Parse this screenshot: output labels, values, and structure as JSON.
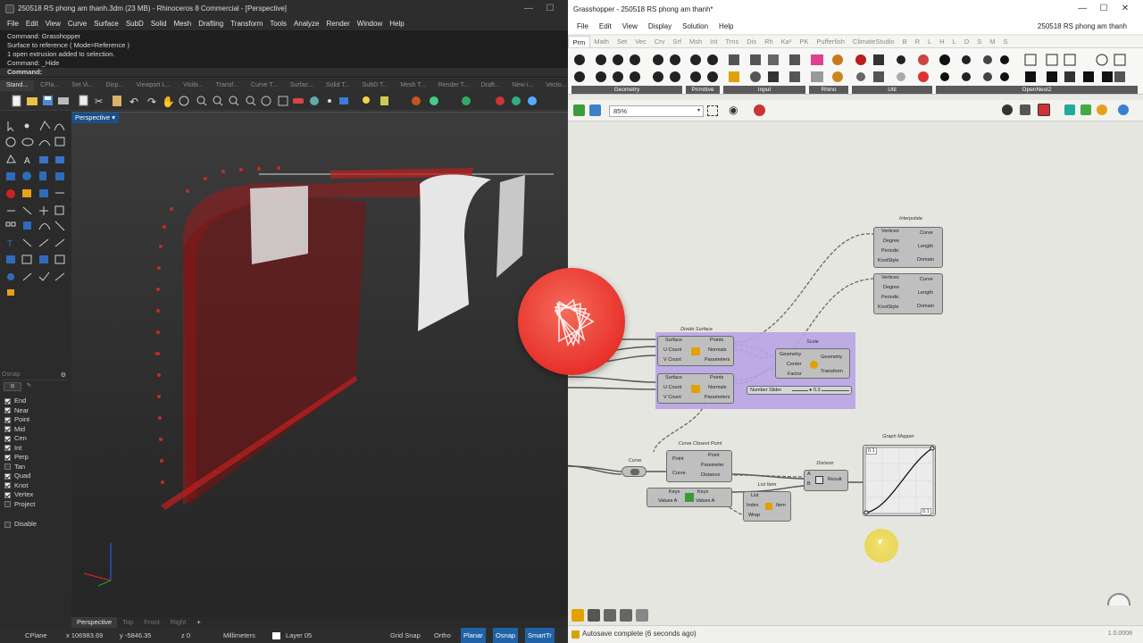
{
  "rhino": {
    "title": "250518 RS phong am thanh.3dm (23 MB) - Rhinoceros 8 Commercial - [Perspective]",
    "menu": [
      "File",
      "Edit",
      "View",
      "Curve",
      "Surface",
      "SubD",
      "Solid",
      "Mesh",
      "Drafting",
      "Transform",
      "Tools",
      "Analyze",
      "Render",
      "Window",
      "Help"
    ],
    "command_history": [
      "Command: Grasshopper",
      "Surface to reference ( Mode=Reference )",
      "1 open extrusion added to selection.",
      "Command: _Hide"
    ],
    "command_prompt": "Command:",
    "toolbar_tabs": [
      "Stand...",
      "CPla...",
      "Set Vi...",
      "Disp...",
      "Viewport L...",
      "Visibi...",
      "Transf...",
      "Curve T...",
      "Surfac...",
      "Solid T...",
      "SubD T...",
      "Mesh T...",
      "Render T...",
      "Draft...",
      "New i...",
      "Vecto..."
    ],
    "viewport_label": "Perspective",
    "osnap_title": "Osnap",
    "osnap_items": [
      {
        "label": "End",
        "checked": true
      },
      {
        "label": "Near",
        "checked": true
      },
      {
        "label": "Point",
        "checked": true
      },
      {
        "label": "Mid",
        "checked": true
      },
      {
        "label": "Cen",
        "checked": true
      },
      {
        "label": "Int",
        "checked": true
      },
      {
        "label": "Perp",
        "checked": true
      },
      {
        "label": "Tan",
        "checked": false
      },
      {
        "label": "Quad",
        "checked": true
      },
      {
        "label": "Knot",
        "checked": true
      },
      {
        "label": "Vertex",
        "checked": true
      },
      {
        "label": "Project",
        "checked": false
      }
    ],
    "osnap_disable": "Disable",
    "viewport_tabs": [
      "Perspective",
      "Top",
      "Front",
      "Right",
      "+"
    ],
    "status": {
      "cplane": "CPlane",
      "x": "x 106983.69",
      "y": "y -5846.35",
      "z": "z 0",
      "units": "Millimeters",
      "layer": "Layer 05",
      "grid_snap": "Grid Snap",
      "ortho": "Ortho",
      "planar": "Planar",
      "osnap": "Osnap",
      "smarttrack": "SmartTr"
    }
  },
  "grasshopper": {
    "title": "Grasshopper - 250518 RS phong am thanh*",
    "menu": [
      "File",
      "Edit",
      "View",
      "Display",
      "Solution",
      "Help"
    ],
    "doc_name": "250518 RS phong am thanh",
    "tabs": [
      "Prm",
      "Math",
      "Set",
      "Vec",
      "Crv",
      "Srf",
      "Msh",
      "Int",
      "Trns",
      "Dis",
      "Rh",
      "Ka²",
      "PK",
      "Pufferfish",
      "ClimateStudio",
      "B",
      "R",
      "L",
      "H",
      "L",
      "D",
      "S",
      "M",
      "S"
    ],
    "ribbon_groups": [
      "Geometry",
      "Primitive",
      "Input",
      "Rhino",
      "Util",
      "OpenNest2"
    ],
    "zoom": "85%",
    "components": {
      "interpolate": {
        "title": "Interpolate",
        "inputs": [
          "Vertices",
          "Degree",
          "Periodic",
          "KnotStyle"
        ],
        "outputs": [
          "Curve",
          "Length",
          "Domain"
        ]
      },
      "interpolate2": {
        "inputs": [
          "Vertices",
          "Degree",
          "Periodic",
          "KnotStyle"
        ],
        "outputs": [
          "Curve",
          "Length",
          "Domain"
        ]
      },
      "divide_surface": {
        "title": "Divide Surface",
        "inputs": [
          "Surface",
          "U Count",
          "V Count"
        ],
        "outputs": [
          "Points",
          "Normals",
          "Parameters"
        ]
      },
      "divide_surface2": {
        "inputs": [
          "Surface",
          "U Count",
          "V Count"
        ],
        "outputs": [
          "Points",
          "Normals",
          "Parameters"
        ]
      },
      "scale": {
        "title": "Scale",
        "inputs": [
          "Geometry",
          "Center",
          "Factor"
        ],
        "outputs": [
          "Geometry",
          "Transform"
        ]
      },
      "number_slider": {
        "label": "Number Slider",
        "value": "0.3"
      },
      "curve_param": {
        "label": "Curve"
      },
      "curve_closest_point": {
        "title": "Curve Closest Point",
        "inputs": [
          "Point",
          "Curve"
        ],
        "outputs": [
          "Point",
          "Parameter",
          "Distance"
        ]
      },
      "keys_values": {
        "inputs": [
          "Keys",
          "Values A"
        ],
        "outputs": [
          "Keys",
          "Values A"
        ]
      },
      "list_item": {
        "title": "List Item",
        "inputs": [
          "List",
          "Index",
          "Wrap"
        ],
        "outputs": [
          "Item"
        ]
      },
      "division": {
        "title": "Division",
        "inputs": [
          "A",
          "B"
        ],
        "outputs": [
          "Result"
        ]
      },
      "graph_mapper": {
        "title": "Graph Mapper",
        "min": "0.1",
        "max": "0.1"
      }
    },
    "status": "Autosave complete (6 seconds ago)",
    "version": "1.0.0008"
  }
}
